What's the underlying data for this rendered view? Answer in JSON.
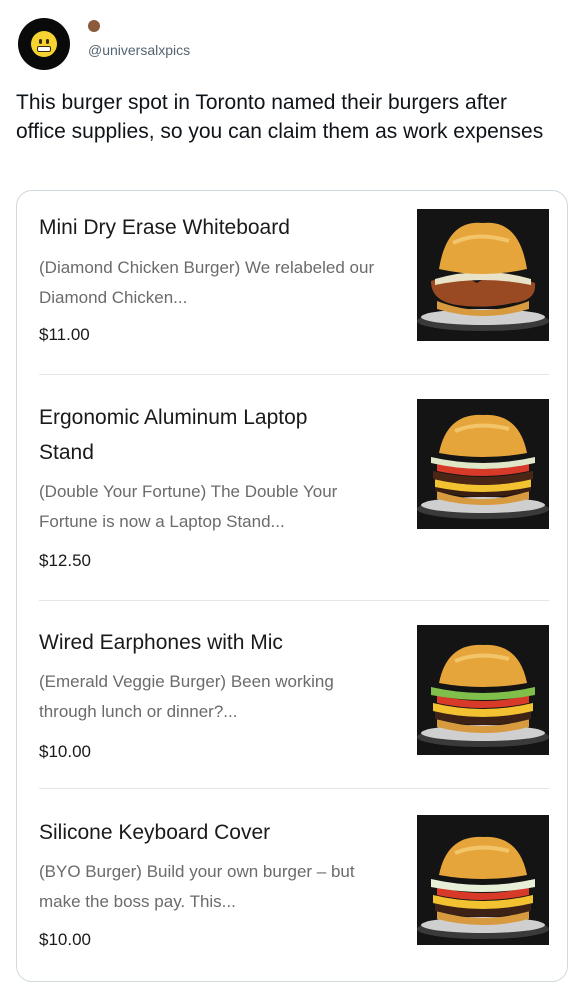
{
  "tweet": {
    "handle": "@universalxpics",
    "text": "This burger spot in Toronto named their burgers after office supplies, so you can claim them as work expenses"
  },
  "menu": {
    "items": [
      {
        "title": "Mini Dry Erase Whiteboard",
        "description": "(Diamond Chicken Burger) We relabeled our Diamond Chicken...",
        "price": "$11.00"
      },
      {
        "title": "Ergonomic Aluminum Laptop Stand",
        "description": "(Double Your Fortune) The Double Your Fortune is now a Laptop Stand...",
        "price": "$12.50"
      },
      {
        "title": "Wired Earphones with Mic",
        "description": "(Emerald Veggie Burger) Been working through lunch or dinner?...",
        "price": "$10.00"
      },
      {
        "title": "Silicone Keyboard Cover",
        "description": "(BYO Burger) Build your own burger – but make the boss pay. This...",
        "price": "$10.00"
      }
    ]
  }
}
